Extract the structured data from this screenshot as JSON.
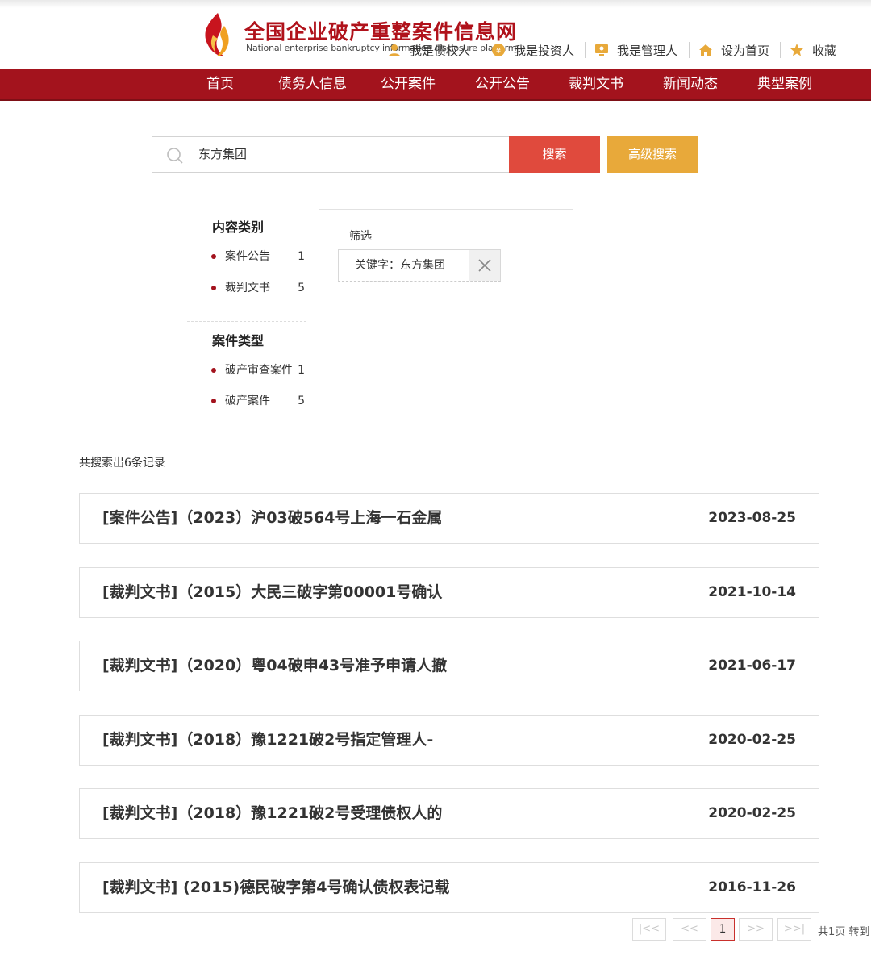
{
  "header": {
    "site_title": "全国企业破产重整案件信息网",
    "site_subtitle": "National enterprise bankruptcy information disclosure platform",
    "quick_links": [
      {
        "label": "我是债权人",
        "icon": "creditor-icon"
      },
      {
        "label": "我是投资人",
        "icon": "investor-icon"
      },
      {
        "label": "我是管理人",
        "icon": "manager-icon"
      },
      {
        "label": "设为首页",
        "icon": "home-icon"
      },
      {
        "label": "收藏",
        "icon": "star-icon"
      }
    ]
  },
  "nav": {
    "items": [
      "首页",
      "债务人信息",
      "公开案件",
      "公开公告",
      "裁判文书",
      "新闻动态",
      "典型案例"
    ]
  },
  "search": {
    "value": "东方集团",
    "search_button": "搜索",
    "advanced_button": "高级搜索"
  },
  "filters": {
    "content_category": {
      "title": "内容类别",
      "items": [
        {
          "label": "案件公告",
          "count": "1"
        },
        {
          "label": "裁判文书",
          "count": "5"
        }
      ]
    },
    "case_type": {
      "title": "案件类型",
      "items": [
        {
          "label": "破产审查案件",
          "count": "1"
        },
        {
          "label": "破产案件",
          "count": "5"
        }
      ]
    },
    "active": {
      "label": "筛选",
      "chip": "关键字：东方集团"
    }
  },
  "results": {
    "summary": "共搜索出6条记录",
    "items": [
      {
        "title": "[案件公告]（2023）沪03破564号上海一石金属",
        "date": "2023-08-25"
      },
      {
        "title": "[裁判文书]（2015）大民三破字第00001号确认",
        "date": "2021-10-14"
      },
      {
        "title": "[裁判文书]（2020）粤04破申43号准予申请人撤",
        "date": "2021-06-17"
      },
      {
        "title": "[裁判文书]（2018）豫1221破2号指定管理人-",
        "date": "2020-02-25"
      },
      {
        "title": "[裁判文书]（2018）豫1221破2号受理债权人的",
        "date": "2020-02-25"
      },
      {
        "title": "[裁判文书] (2015)德民破字第4号确认债权表记载",
        "date": "2016-11-26"
      }
    ]
  },
  "pagination": {
    "first": "|<<",
    "prev": "<<",
    "current": "1",
    "next": ">>",
    "last": ">>|",
    "info": "共1页 转到"
  },
  "colors": {
    "brand_red": "#a3131d",
    "search_red": "#e04a3d",
    "advanced_orange": "#e8a93a"
  }
}
